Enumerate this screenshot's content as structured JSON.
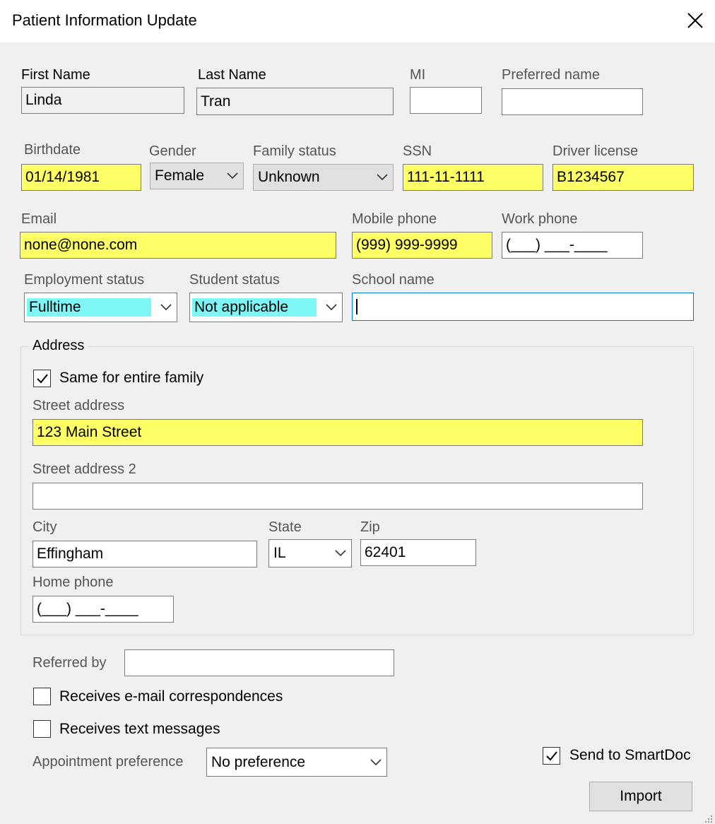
{
  "window": {
    "title": "Patient Information Update",
    "close_glyph": "✕"
  },
  "name": {
    "first_label": "First Name",
    "first_value": "Linda",
    "last_label": "Last Name",
    "last_value": "Tran",
    "mi_label": "MI",
    "mi_value": "",
    "preferred_label": "Preferred name",
    "preferred_value": ""
  },
  "demographics": {
    "birthdate_label": "Birthdate",
    "birthdate_value": "01/14/1981",
    "gender_label": "Gender",
    "gender_value": "Female",
    "family_status_label": "Family status",
    "family_status_value": "Unknown",
    "ssn_label": "SSN",
    "ssn_value": "111-11-1111",
    "driver_license_label": "Driver license",
    "driver_license_value": "B1234567"
  },
  "contact": {
    "email_label": "Email",
    "email_value": "none@none.com",
    "mobile_label": "Mobile phone",
    "mobile_value": "(999) 999-9999",
    "work_label": "Work phone",
    "work_value": "(___) ___-____"
  },
  "status": {
    "employment_label": "Employment status",
    "employment_value": "Fulltime",
    "student_label": "Student status",
    "student_value": "Not applicable",
    "school_label": "School name",
    "school_value": ""
  },
  "address": {
    "group_title": "Address",
    "same_family_label": "Same for entire family",
    "same_family_checked": true,
    "street_label": "Street address",
    "street_value": "123 Main Street",
    "street2_label": "Street address 2",
    "street2_value": "",
    "city_label": "City",
    "city_value": "Effingham",
    "state_label": "State",
    "state_value": "IL",
    "zip_label": "Zip",
    "zip_value": "62401",
    "home_phone_label": "Home phone",
    "home_phone_value": "(___) ___-____"
  },
  "other": {
    "referred_label": "Referred by",
    "referred_value": "",
    "email_corr_label": "Receives e-mail correspondences",
    "email_corr_checked": false,
    "text_msg_label": "Receives text messages",
    "text_msg_checked": false,
    "appt_pref_label": "Appointment preference",
    "appt_pref_value": "No preference",
    "smartdoc_label": "Send to SmartDoc",
    "smartdoc_checked": true,
    "import_label": "Import"
  },
  "colors": {
    "required_highlight": "#ffff66",
    "selection_highlight": "#7ff6f6",
    "focus_border": "#0078d7",
    "background": "#f0f0f0"
  }
}
